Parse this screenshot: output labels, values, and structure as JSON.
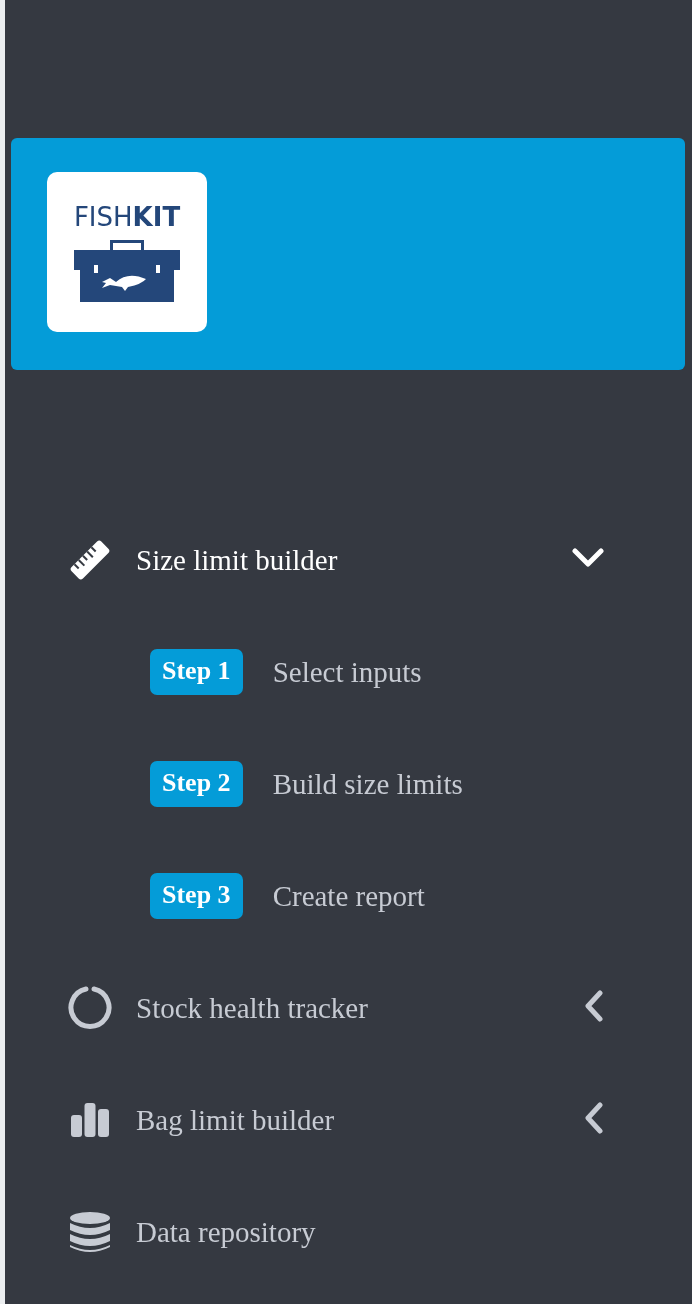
{
  "logo": {
    "text": "FISH**KIT**"
  },
  "menu": [
    {
      "kind": "group",
      "label": "Size limit builder",
      "expanded": true,
      "children": [
        {
          "badge": "Step 1",
          "label": "Select inputs"
        },
        {
          "badge": "Step 2",
          "label": "Build size limits"
        },
        {
          "badge": "Step 3",
          "label": "Create report"
        }
      ]
    },
    {
      "kind": "group",
      "label": "Stock health tracker",
      "expanded": false
    },
    {
      "kind": "group",
      "label": "Bag limit builder",
      "expanded": false
    },
    {
      "kind": "link",
      "label": "Data repository"
    }
  ]
}
